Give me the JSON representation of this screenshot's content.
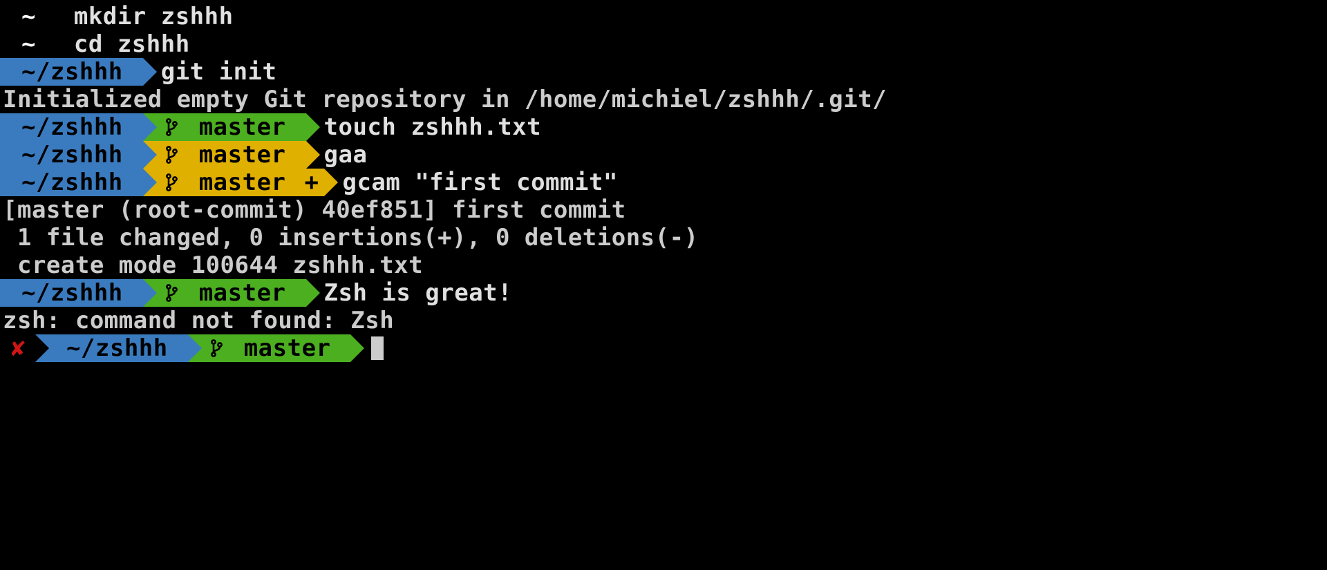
{
  "colors": {
    "blue": "#3a7bbf",
    "green": "#4caf20",
    "yellow": "#e0b000",
    "red": "#d01515",
    "bg": "#000000",
    "fg": "#cccccc"
  },
  "lines": [
    {
      "type": "prompt",
      "segs": [
        {
          "color": "black",
          "text": " ~ "
        }
      ],
      "cmd": "mkdir zshhh"
    },
    {
      "type": "prompt",
      "segs": [
        {
          "color": "black",
          "text": " ~ "
        }
      ],
      "cmd": "cd zshhh"
    },
    {
      "type": "prompt",
      "segs": [
        {
          "color": "blue",
          "text": " ~/zshhh "
        }
      ],
      "cmd": "git init"
    },
    {
      "type": "output",
      "text": "Initialized empty Git repository in /home/michiel/zshhh/.git/"
    },
    {
      "type": "prompt",
      "segs": [
        {
          "color": "blue",
          "text": " ~/zshhh "
        },
        {
          "color": "green",
          "branch": true,
          "text": " master "
        }
      ],
      "cmd": "touch zshhh.txt"
    },
    {
      "type": "prompt",
      "segs": [
        {
          "color": "blue",
          "text": " ~/zshhh "
        },
        {
          "color": "yellow",
          "branch": true,
          "text": " master "
        }
      ],
      "cmd": "gaa"
    },
    {
      "type": "prompt",
      "segs": [
        {
          "color": "blue",
          "text": " ~/zshhh "
        },
        {
          "color": "yellow",
          "branch": true,
          "text": " master ",
          "plus": true
        }
      ],
      "cmd": "gcam \"first commit\""
    },
    {
      "type": "output",
      "text": "[master (root-commit) 40ef851] first commit"
    },
    {
      "type": "output",
      "text": " 1 file changed, 0 insertions(+), 0 deletions(-)"
    },
    {
      "type": "output",
      "text": " create mode 100644 zshhh.txt"
    },
    {
      "type": "prompt",
      "segs": [
        {
          "color": "blue",
          "text": " ~/zshhh "
        },
        {
          "color": "green",
          "branch": true,
          "text": " master "
        }
      ],
      "cmd": "Zsh is great!"
    },
    {
      "type": "output",
      "text": "zsh: command not found: Zsh"
    },
    {
      "type": "prompt",
      "segs": [
        {
          "color": "black",
          "err": true,
          "text": ""
        },
        {
          "color": "blue",
          "text": " ~/zshhh "
        },
        {
          "color": "green",
          "branch": true,
          "text": " master "
        }
      ],
      "cmd": "",
      "cursor": true
    }
  ],
  "icons": {
    "branch": "git-branch-icon",
    "plus": "+",
    "err": "✘"
  }
}
